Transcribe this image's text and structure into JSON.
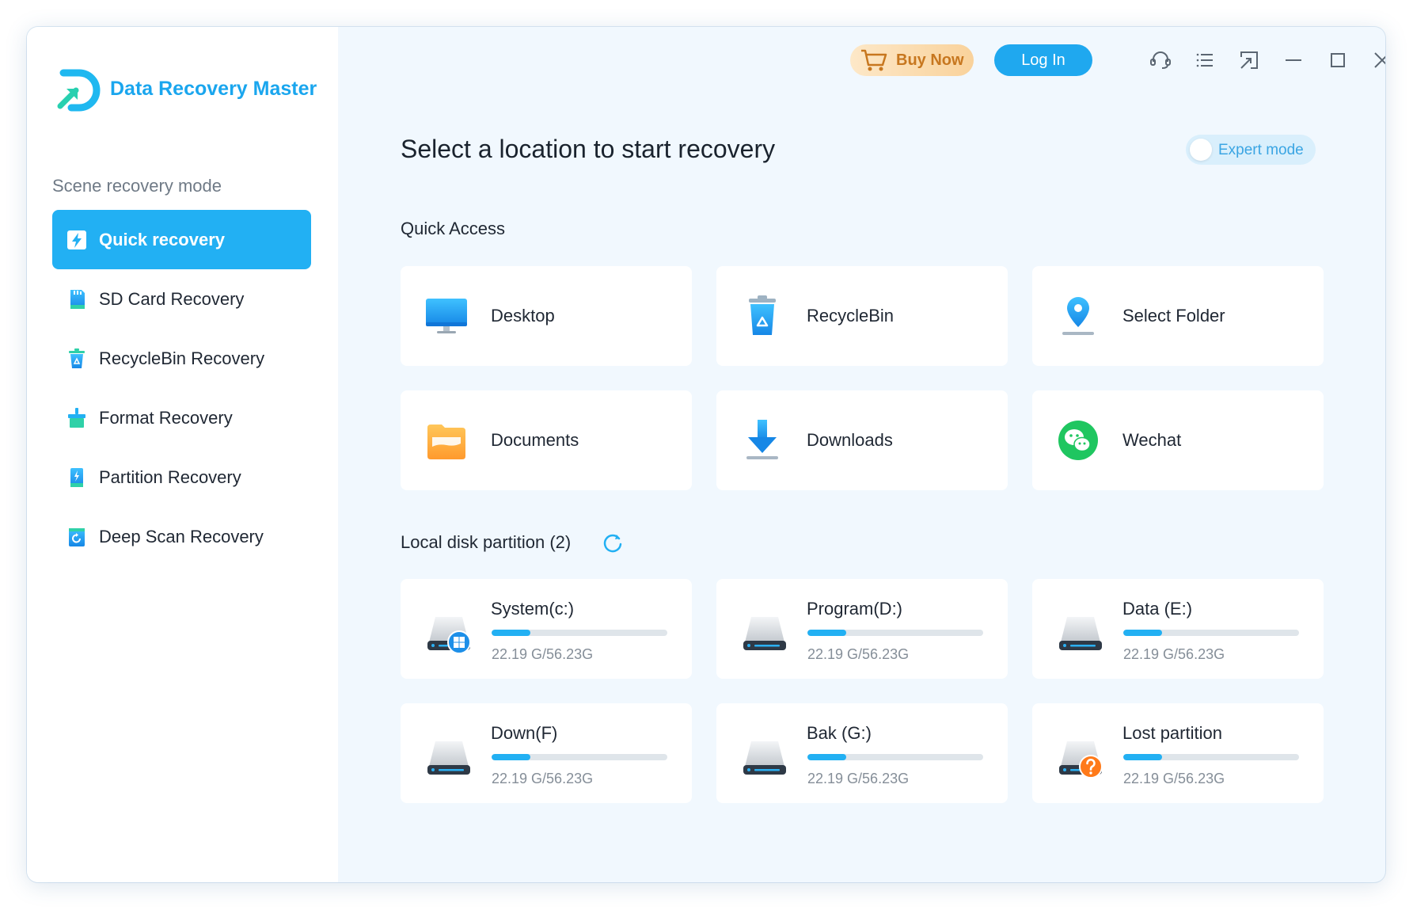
{
  "app": {
    "title": "Data Recovery Master"
  },
  "sidebar": {
    "section_title": "Scene recovery mode",
    "items": [
      {
        "label": "Quick recovery",
        "icon": "lightning-icon",
        "active": true
      },
      {
        "label": "SD Card Recovery",
        "icon": "sd-card-icon",
        "active": false
      },
      {
        "label": "RecycleBin Recovery",
        "icon": "recycle-bin-icon",
        "active": false
      },
      {
        "label": "Format Recovery",
        "icon": "format-brush-icon",
        "active": false
      },
      {
        "label": "Partition Recovery",
        "icon": "partition-icon",
        "active": false
      },
      {
        "label": "Deep Scan Recovery",
        "icon": "deep-scan-icon",
        "active": false
      }
    ]
  },
  "header": {
    "buy_now": "Buy Now",
    "log_in": "Log In",
    "window_controls": [
      "support-icon",
      "menu-list-icon",
      "share-icon",
      "minimize-icon",
      "maximize-icon",
      "close-icon"
    ]
  },
  "main": {
    "title": "Select a location to start recovery",
    "expert_mode": "Expert mode",
    "expert_mode_on": false,
    "quick_access": {
      "title": "Quick Access",
      "items": [
        {
          "label": "Desktop",
          "icon": "desktop-icon"
        },
        {
          "label": "RecycleBin",
          "icon": "recycle-bin-icon"
        },
        {
          "label": "Select Folder",
          "icon": "location-pin-icon"
        },
        {
          "label": "Documents",
          "icon": "folder-icon"
        },
        {
          "label": "Downloads",
          "icon": "download-icon"
        },
        {
          "label": "Wechat",
          "icon": "wechat-icon"
        }
      ]
    },
    "local_disk": {
      "title": "Local disk partition (2)",
      "partitions": [
        {
          "name": "System(c:)",
          "size": "22.19 G/56.23G",
          "used_fraction": 0.22,
          "badge": "windows"
        },
        {
          "name": "Program(D:)",
          "size": "22.19 G/56.23G",
          "used_fraction": 0.22,
          "badge": ""
        },
        {
          "name": "Data (E:)",
          "size": "22.19 G/56.23G",
          "used_fraction": 0.22,
          "badge": ""
        },
        {
          "name": "Down(F)",
          "size": "22.19 G/56.23G",
          "used_fraction": 0.22,
          "badge": ""
        },
        {
          "name": "Bak (G:)",
          "size": "22.19 G/56.23G",
          "used_fraction": 0.22,
          "badge": ""
        },
        {
          "name": "Lost partition",
          "size": "22.19 G/56.23G",
          "used_fraction": 0.22,
          "badge": "question"
        }
      ]
    }
  },
  "colors": {
    "accent": "#22b0f3",
    "buy_text": "#c7771f",
    "page_bg": "#f1f8fe"
  }
}
